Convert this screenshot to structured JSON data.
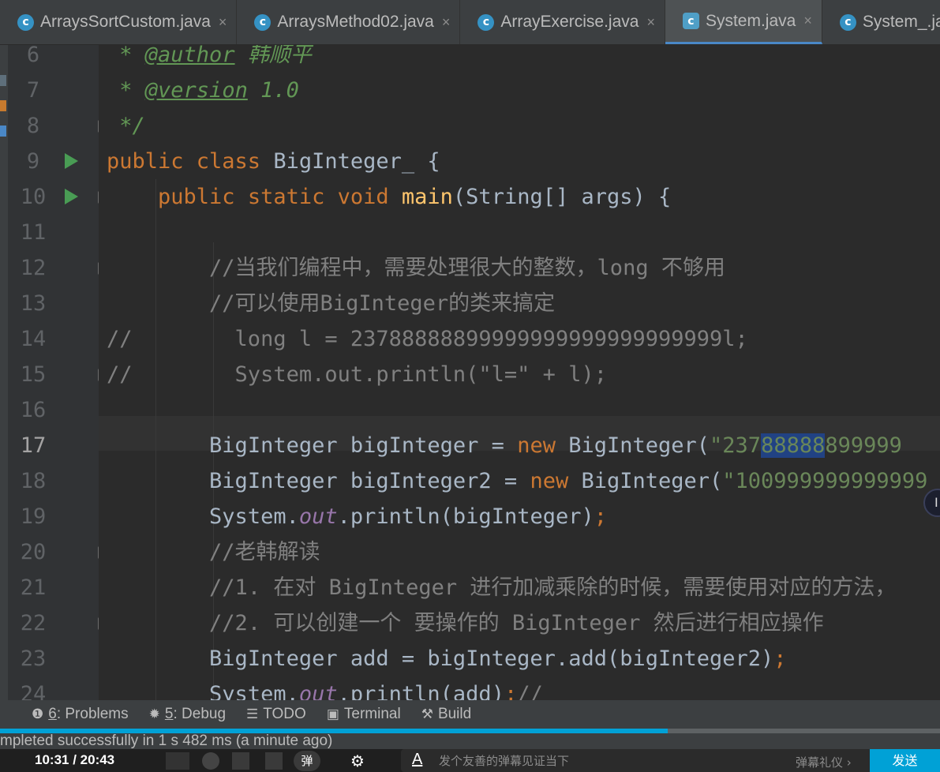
{
  "tabs": [
    {
      "label": "ArraysSortCustom.java",
      "icon": "c",
      "active": false
    },
    {
      "label": "ArraysMethod02.java",
      "icon": "c",
      "active": false
    },
    {
      "label": "ArrayExercise.java",
      "icon": "c",
      "active": false
    },
    {
      "label": "System.java",
      "icon": "c",
      "active": true
    },
    {
      "label": "System_.java",
      "icon": "c",
      "active": false
    }
  ],
  "tab_close_glyph": "×",
  "editor": {
    "line_numbers": [
      "6",
      "7",
      "8",
      "9",
      "10",
      "11",
      "12",
      "13",
      "14",
      "15",
      "16",
      "17",
      "18",
      "19",
      "20",
      "21",
      "22",
      "23",
      "24"
    ],
    "current_line": "17",
    "lines": [
      {
        "indent": "",
        "tokens": [
          {
            "t": " * ",
            "c": "doc"
          },
          {
            "t": "@author",
            "c": "doctag"
          },
          {
            "t": " 韩顺平",
            "c": "doc"
          }
        ]
      },
      {
        "indent": "",
        "tokens": [
          {
            "t": " * ",
            "c": "doc"
          },
          {
            "t": "@version",
            "c": "doctag"
          },
          {
            "t": " 1.0",
            "c": "doc"
          }
        ]
      },
      {
        "indent": "",
        "tokens": [
          {
            "t": " */",
            "c": "doc"
          }
        ]
      },
      {
        "indent": "",
        "tokens": [
          {
            "t": "public class ",
            "c": "kw"
          },
          {
            "t": "BigInteger_ {",
            "c": ""
          }
        ]
      },
      {
        "indent": "    ",
        "tokens": [
          {
            "t": "public static void ",
            "c": "kw"
          },
          {
            "t": "main",
            "c": "fn"
          },
          {
            "t": "(String[] args) {",
            "c": ""
          }
        ]
      },
      {
        "indent": "",
        "tokens": []
      },
      {
        "indent": "        ",
        "tokens": [
          {
            "t": "//当我们编程中，需要处理很大的整数，long 不够用",
            "c": "cmt"
          }
        ]
      },
      {
        "indent": "        ",
        "tokens": [
          {
            "t": "//可以使用BigInteger的类来搞定",
            "c": "cmt"
          }
        ]
      },
      {
        "indent": "",
        "tokens": [
          {
            "t": "//        long l = 23788888899999999999999999999l;",
            "c": "cmt"
          }
        ]
      },
      {
        "indent": "",
        "tokens": [
          {
            "t": "//        System.out.println(\"l=\" + l);",
            "c": "cmt"
          }
        ]
      },
      {
        "indent": "",
        "tokens": []
      },
      {
        "indent": "        ",
        "tokens": [
          {
            "t": "BigInteger bigInteger = ",
            "c": ""
          },
          {
            "t": "new ",
            "c": "kw"
          },
          {
            "t": "BigInteger(",
            "c": ""
          },
          {
            "t": "\"237",
            "c": "str"
          },
          {
            "t": "88888",
            "c": "str sel"
          },
          {
            "t": "899999",
            "c": "str"
          }
        ]
      },
      {
        "indent": "        ",
        "tokens": [
          {
            "t": "BigInteger bigInteger2 = ",
            "c": ""
          },
          {
            "t": "new ",
            "c": "kw"
          },
          {
            "t": "BigInteger(",
            "c": ""
          },
          {
            "t": "\"100999999999999",
            "c": "str"
          }
        ]
      },
      {
        "indent": "        ",
        "tokens": [
          {
            "t": "System.",
            "c": ""
          },
          {
            "t": "out",
            "c": "static"
          },
          {
            "t": ".println(bigInteger)",
            "c": ""
          },
          {
            "t": ";",
            "c": "kw"
          }
        ]
      },
      {
        "indent": "        ",
        "tokens": [
          {
            "t": "//老韩解读",
            "c": "cmt"
          }
        ]
      },
      {
        "indent": "        ",
        "tokens": [
          {
            "t": "//1. 在对 BigInteger 进行加减乘除的时候，需要使用对应的方法，",
            "c": "cmt"
          }
        ]
      },
      {
        "indent": "        ",
        "tokens": [
          {
            "t": "//2. 可以创建一个 要操作的 BigInteger 然后进行相应操作",
            "c": "cmt"
          }
        ]
      },
      {
        "indent": "        ",
        "tokens": [
          {
            "t": "BigInteger add = bigInteger.add(bigInteger2)",
            "c": ""
          },
          {
            "t": ";",
            "c": "kw"
          }
        ]
      },
      {
        "indent": "        ",
        "tokens": [
          {
            "t": "System.",
            "c": ""
          },
          {
            "t": "out",
            "c": "static"
          },
          {
            "t": ".println(add)",
            "c": ""
          },
          {
            "t": ";",
            "c": "kw"
          },
          {
            "t": "//",
            "c": "cmt"
          }
        ]
      }
    ],
    "run_lines": [
      "9",
      "10"
    ],
    "fold_lines": [
      "8",
      "10",
      "12",
      "15",
      "20",
      "22"
    ]
  },
  "tool_windows": [
    {
      "icon": "problems-icon",
      "glyph": "❶",
      "num": "6",
      "label": ": Problems"
    },
    {
      "icon": "debug-icon",
      "glyph": "✹",
      "num": "5",
      "label": ": Debug"
    },
    {
      "icon": "todo-icon",
      "glyph": "☰",
      "num": "",
      "label": "TODO"
    },
    {
      "icon": "terminal-icon",
      "glyph": "▣",
      "num": "",
      "label": "Terminal"
    },
    {
      "icon": "build-icon",
      "glyph": "⚒",
      "num": "",
      "label": "Build"
    }
  ],
  "status_text": "mpleted successfully in 1 s 482 ms (a minute ago)",
  "player": {
    "current_time": "10:31",
    "separator": " / ",
    "total_time": "20:43",
    "progress_fraction": 0.71,
    "danmaku_toggle_label": "弹",
    "danmaku_placeholder": "发个友善的弹幕见证当下",
    "danmaku_a": "A",
    "etiquette_label": "弹幕礼仪 ›",
    "send_label": "发送"
  },
  "colors": {
    "keyword": "#cc7832",
    "function": "#ffc66d",
    "string": "#6a8759",
    "comment": "#808080",
    "doc": "#629755",
    "static_field": "#9876aa",
    "accent": "#00a1d6"
  }
}
